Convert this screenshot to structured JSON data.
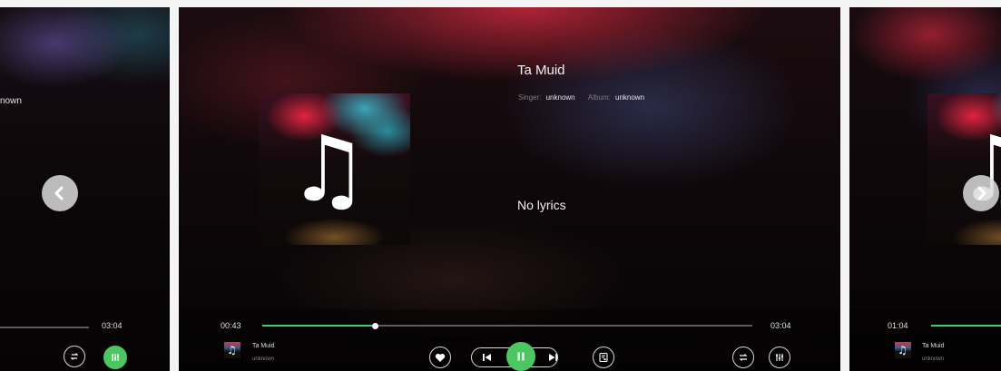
{
  "left_card": {
    "artist_fragment": "nown",
    "total_time": "03:04"
  },
  "main_card": {
    "song_title": "Ta Muid",
    "singer_label": "Singer:",
    "singer_value": "unknown",
    "album_label": "Album:",
    "album_value": "unknown",
    "lyrics": "No lyrics",
    "current_time": "00:43",
    "total_time": "03:04",
    "progress": 0.23,
    "mini_title": "Ta Muid",
    "mini_artist": "unknown"
  },
  "right_card": {
    "current_time": "01:04",
    "mini_title": "Ta Muid",
    "mini_artist": "unknown"
  },
  "icons": {
    "prev_nav": "chevron-left-icon",
    "next_nav": "chevron-right-icon",
    "favorite": "heart-icon",
    "previous": "skip-previous-icon",
    "play_pause": "pause-icon",
    "next": "skip-next-icon",
    "lyrics": "lyrics-icon",
    "play_mode": "shuffle-icon",
    "equalizer": "equalizer-icon",
    "music_note": "music-note-icon"
  },
  "colors": {
    "accent": "#4cc660",
    "progress": "#3ecf6a"
  }
}
